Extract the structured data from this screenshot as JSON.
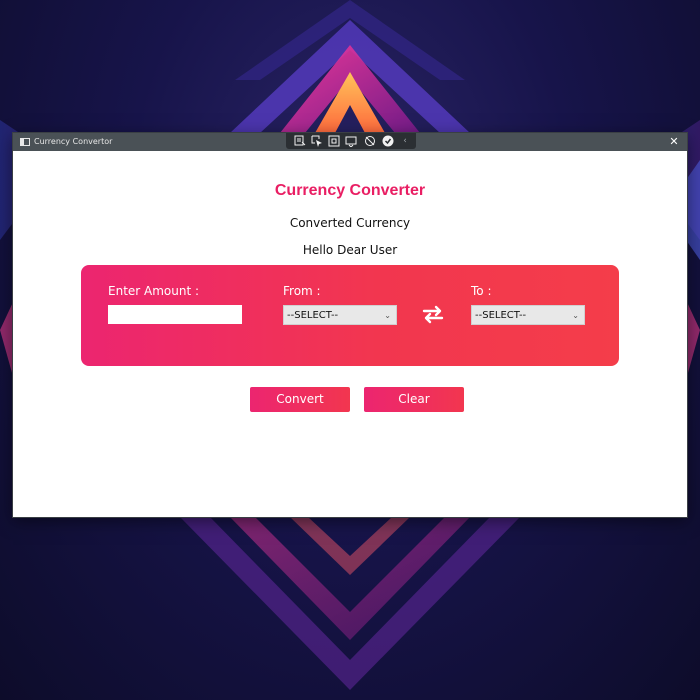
{
  "window": {
    "title": "Currency Convertor",
    "close_glyph": "✕",
    "toolbar_icons": [
      "select-window-icon",
      "select-region-icon",
      "fullscreen-icon",
      "record-icon",
      "mute-icon",
      "done-icon",
      "collapse-icon"
    ]
  },
  "app": {
    "heading": "Currency Converter",
    "converted_label": "Converted Currency",
    "greeting": "Hello Dear User",
    "amount_label": "Enter Amount :",
    "amount_value": "",
    "from_label": "From :",
    "from_selected": "--SELECT--",
    "to_label": "To :",
    "to_selected": "--SELECT--",
    "convert_label": "Convert",
    "clear_label": "Clear"
  },
  "colors": {
    "accent_pink": "#e91e63",
    "accent_red": "#f43d4a",
    "titlebar": "#4a5156"
  }
}
